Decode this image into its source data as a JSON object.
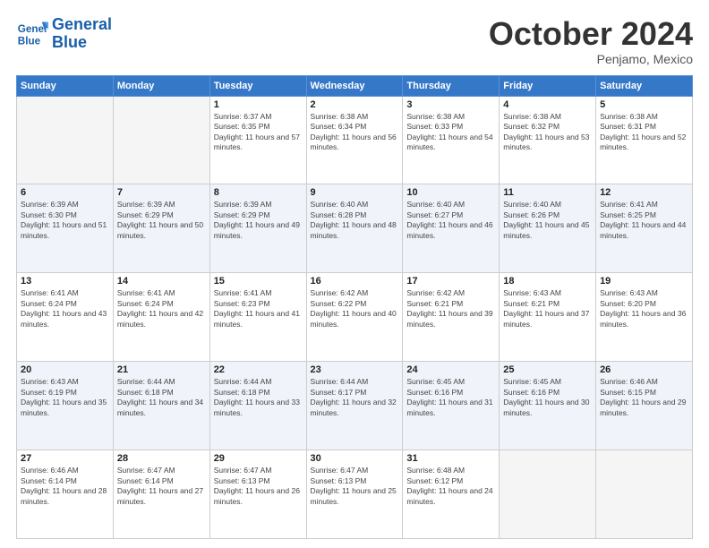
{
  "header": {
    "logo_line1": "General",
    "logo_line2": "Blue",
    "title": "October 2024",
    "subtitle": "Penjamo, Mexico"
  },
  "days_of_week": [
    "Sunday",
    "Monday",
    "Tuesday",
    "Wednesday",
    "Thursday",
    "Friday",
    "Saturday"
  ],
  "weeks": [
    [
      {
        "day": "",
        "empty": true
      },
      {
        "day": "",
        "empty": true
      },
      {
        "day": "1",
        "sunrise": "6:37 AM",
        "sunset": "6:35 PM",
        "daylight": "11 hours and 57 minutes."
      },
      {
        "day": "2",
        "sunrise": "6:38 AM",
        "sunset": "6:34 PM",
        "daylight": "11 hours and 56 minutes."
      },
      {
        "day": "3",
        "sunrise": "6:38 AM",
        "sunset": "6:33 PM",
        "daylight": "11 hours and 54 minutes."
      },
      {
        "day": "4",
        "sunrise": "6:38 AM",
        "sunset": "6:32 PM",
        "daylight": "11 hours and 53 minutes."
      },
      {
        "day": "5",
        "sunrise": "6:38 AM",
        "sunset": "6:31 PM",
        "daylight": "11 hours and 52 minutes."
      }
    ],
    [
      {
        "day": "6",
        "sunrise": "6:39 AM",
        "sunset": "6:30 PM",
        "daylight": "11 hours and 51 minutes."
      },
      {
        "day": "7",
        "sunrise": "6:39 AM",
        "sunset": "6:29 PM",
        "daylight": "11 hours and 50 minutes."
      },
      {
        "day": "8",
        "sunrise": "6:39 AM",
        "sunset": "6:29 PM",
        "daylight": "11 hours and 49 minutes."
      },
      {
        "day": "9",
        "sunrise": "6:40 AM",
        "sunset": "6:28 PM",
        "daylight": "11 hours and 48 minutes."
      },
      {
        "day": "10",
        "sunrise": "6:40 AM",
        "sunset": "6:27 PM",
        "daylight": "11 hours and 46 minutes."
      },
      {
        "day": "11",
        "sunrise": "6:40 AM",
        "sunset": "6:26 PM",
        "daylight": "11 hours and 45 minutes."
      },
      {
        "day": "12",
        "sunrise": "6:41 AM",
        "sunset": "6:25 PM",
        "daylight": "11 hours and 44 minutes."
      }
    ],
    [
      {
        "day": "13",
        "sunrise": "6:41 AM",
        "sunset": "6:24 PM",
        "daylight": "11 hours and 43 minutes."
      },
      {
        "day": "14",
        "sunrise": "6:41 AM",
        "sunset": "6:24 PM",
        "daylight": "11 hours and 42 minutes."
      },
      {
        "day": "15",
        "sunrise": "6:41 AM",
        "sunset": "6:23 PM",
        "daylight": "11 hours and 41 minutes."
      },
      {
        "day": "16",
        "sunrise": "6:42 AM",
        "sunset": "6:22 PM",
        "daylight": "11 hours and 40 minutes."
      },
      {
        "day": "17",
        "sunrise": "6:42 AM",
        "sunset": "6:21 PM",
        "daylight": "11 hours and 39 minutes."
      },
      {
        "day": "18",
        "sunrise": "6:43 AM",
        "sunset": "6:21 PM",
        "daylight": "11 hours and 37 minutes."
      },
      {
        "day": "19",
        "sunrise": "6:43 AM",
        "sunset": "6:20 PM",
        "daylight": "11 hours and 36 minutes."
      }
    ],
    [
      {
        "day": "20",
        "sunrise": "6:43 AM",
        "sunset": "6:19 PM",
        "daylight": "11 hours and 35 minutes."
      },
      {
        "day": "21",
        "sunrise": "6:44 AM",
        "sunset": "6:18 PM",
        "daylight": "11 hours and 34 minutes."
      },
      {
        "day": "22",
        "sunrise": "6:44 AM",
        "sunset": "6:18 PM",
        "daylight": "11 hours and 33 minutes."
      },
      {
        "day": "23",
        "sunrise": "6:44 AM",
        "sunset": "6:17 PM",
        "daylight": "11 hours and 32 minutes."
      },
      {
        "day": "24",
        "sunrise": "6:45 AM",
        "sunset": "6:16 PM",
        "daylight": "11 hours and 31 minutes."
      },
      {
        "day": "25",
        "sunrise": "6:45 AM",
        "sunset": "6:16 PM",
        "daylight": "11 hours and 30 minutes."
      },
      {
        "day": "26",
        "sunrise": "6:46 AM",
        "sunset": "6:15 PM",
        "daylight": "11 hours and 29 minutes."
      }
    ],
    [
      {
        "day": "27",
        "sunrise": "6:46 AM",
        "sunset": "6:14 PM",
        "daylight": "11 hours and 28 minutes."
      },
      {
        "day": "28",
        "sunrise": "6:47 AM",
        "sunset": "6:14 PM",
        "daylight": "11 hours and 27 minutes."
      },
      {
        "day": "29",
        "sunrise": "6:47 AM",
        "sunset": "6:13 PM",
        "daylight": "11 hours and 26 minutes."
      },
      {
        "day": "30",
        "sunrise": "6:47 AM",
        "sunset": "6:13 PM",
        "daylight": "11 hours and 25 minutes."
      },
      {
        "day": "31",
        "sunrise": "6:48 AM",
        "sunset": "6:12 PM",
        "daylight": "11 hours and 24 minutes."
      },
      {
        "day": "",
        "empty": true
      },
      {
        "day": "",
        "empty": true
      }
    ]
  ]
}
